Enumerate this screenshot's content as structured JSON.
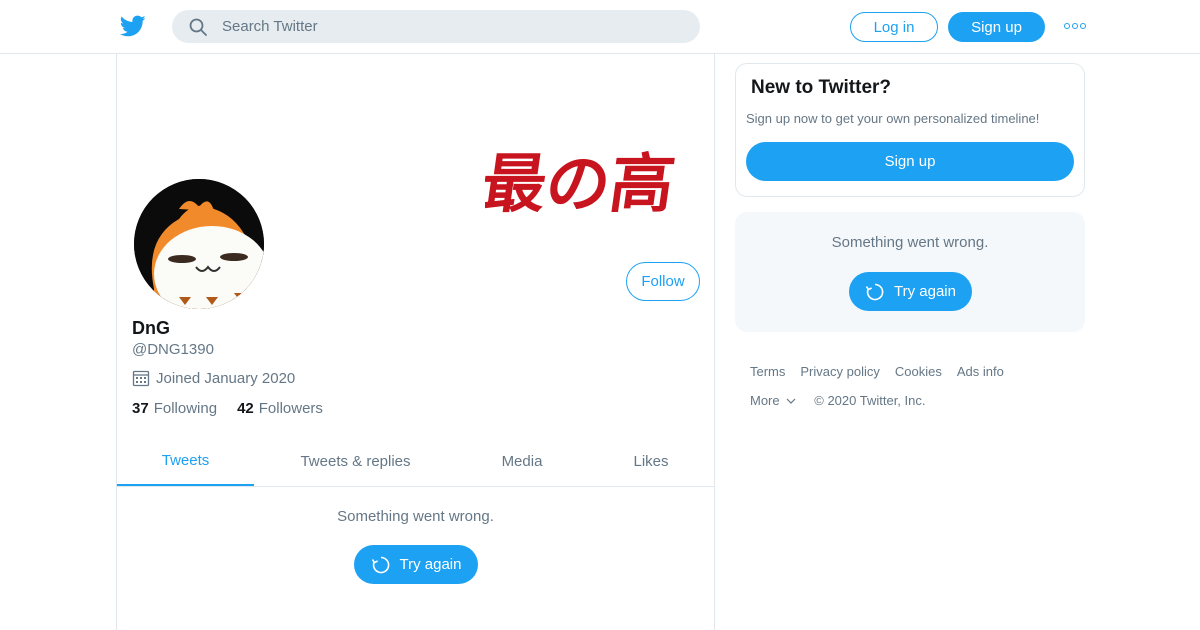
{
  "header": {
    "search_placeholder": "Search Twitter",
    "login_label": "Log in",
    "signup_label": "Sign up",
    "logo_icon": "twitter-bird-icon",
    "more_icon": "more-dots-icon"
  },
  "profile": {
    "display_name": "DnG",
    "handle": "@DNG1390",
    "joined": "Joined January 2020",
    "following_count": "37",
    "following_label": "Following",
    "followers_count": "42",
    "followers_label": "Followers",
    "follow_label": "Follow",
    "banner_text": "最の高"
  },
  "tabs": [
    {
      "label": "Tweets",
      "active": true
    },
    {
      "label": "Tweets & replies",
      "active": false
    },
    {
      "label": "Media",
      "active": false
    },
    {
      "label": "Likes",
      "active": false
    }
  ],
  "timeline": {
    "error_message": "Something went wrong.",
    "retry_label": "Try again"
  },
  "sidebar": {
    "new_title": "New to Twitter?",
    "new_subtitle": "Sign up now to get your own personalized timeline!",
    "new_signup_label": "Sign up",
    "error_message": "Something went wrong.",
    "retry_label": "Try again"
  },
  "footer": {
    "links": [
      "Terms",
      "Privacy policy",
      "Cookies",
      "Ads info"
    ],
    "more_label": "More",
    "copyright": "© 2020 Twitter, Inc."
  },
  "colors": {
    "accent": "#1da1f2",
    "muted_text": "#657786",
    "border": "#e1e8ed",
    "banner_text": "#c8141e"
  }
}
